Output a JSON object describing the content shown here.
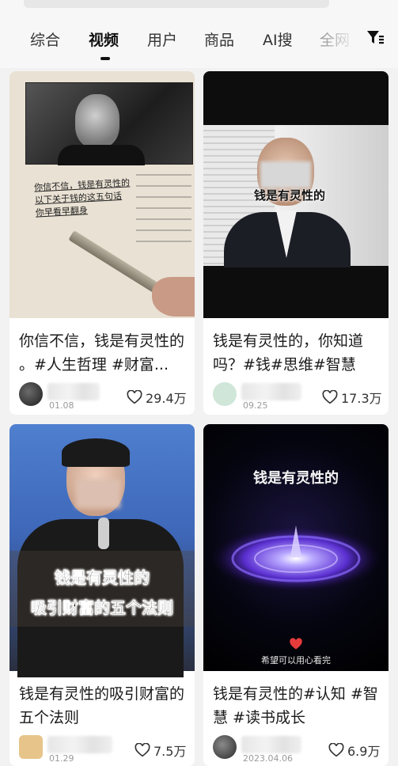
{
  "tabs": [
    {
      "label": "综合"
    },
    {
      "label": "视频"
    },
    {
      "label": "用户"
    },
    {
      "label": "商品"
    },
    {
      "label": "AI搜"
    },
    {
      "label": "全网"
    }
  ],
  "active_tab": "视频",
  "icons": {
    "filter": "filter-icon",
    "heart": "heart-outline-icon"
  },
  "cards": [
    {
      "thumb_text": [
        "你信不信，钱是有灵性的",
        "以下关于钱的这五句话",
        "你早看早翻身"
      ],
      "caption": "你信不信，钱是有灵性的 。#人生哲理 #财富...",
      "date": "01.08",
      "likes": "29.4万"
    },
    {
      "thumb_text": [
        "钱是有灵性的"
      ],
      "caption": "钱是有灵性的，你知道吗？#钱#思维#智慧#...",
      "date": "09.25",
      "likes": "17.3万"
    },
    {
      "thumb_text": [
        "钱是有灵性的",
        "吸引财富的五个法则"
      ],
      "caption": "钱是有灵性的吸引财富的五个法则",
      "date": "01.29",
      "likes": "7.5万"
    },
    {
      "thumb_text": [
        "钱是有灵性的",
        "希望可以用心看完"
      ],
      "caption": "钱是有灵性的#认知 #智慧 #读书成长",
      "date": "2023.04.06",
      "likes": "6.9万"
    }
  ]
}
